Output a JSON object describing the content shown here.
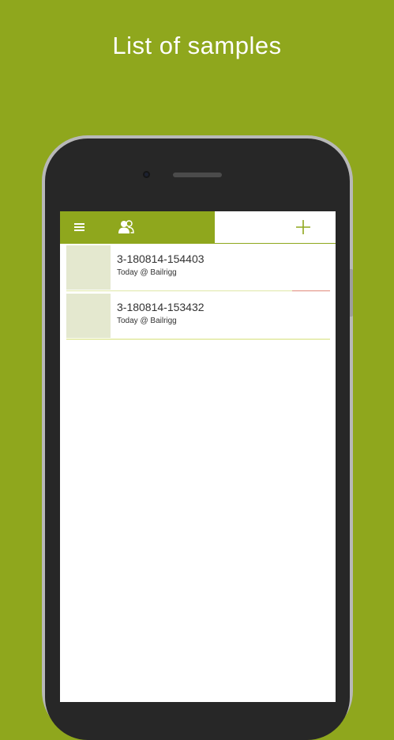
{
  "headline": "List of samples",
  "appbar": {
    "menu_icon": "hamburger-menu-icon",
    "users_icon": "users-icon",
    "add_icon": "plus-icon",
    "accent_color": "#8fa71d"
  },
  "samples": [
    {
      "title": "3-180814-154403",
      "subtitle": "Today @ Bailrigg",
      "status": "error"
    },
    {
      "title": "3-180814-153432",
      "subtitle": "Today @ Bailrigg",
      "status": "ok"
    }
  ]
}
